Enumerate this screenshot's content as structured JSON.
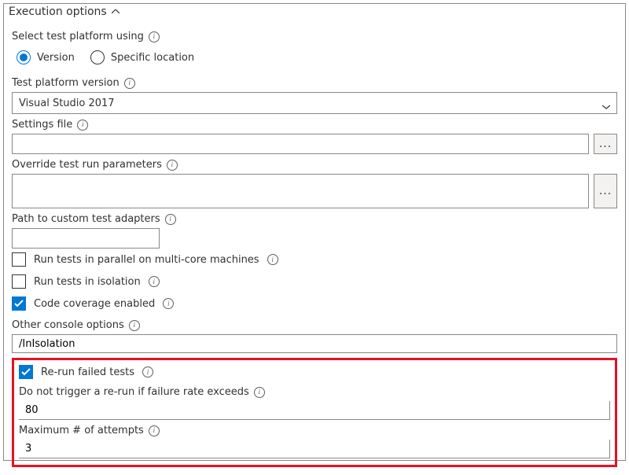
{
  "header": {
    "title": "Execution options"
  },
  "selectPlatform": {
    "label": "Select test platform using",
    "options": {
      "version": "Version",
      "specific": "Specific location"
    },
    "selected": "version"
  },
  "platformVersion": {
    "label": "Test platform version",
    "value": "Visual Studio 2017"
  },
  "settingsFile": {
    "label": "Settings file",
    "value": ""
  },
  "overrideParams": {
    "label": "Override test run parameters",
    "value": ""
  },
  "customAdapters": {
    "label": "Path to custom test adapters",
    "value": ""
  },
  "checkboxes": {
    "parallel": "Run tests in parallel on multi-core machines",
    "isolation": "Run tests in isolation",
    "coverage": "Code coverage enabled"
  },
  "otherConsole": {
    "label": "Other console options",
    "value": "/InIsolation"
  },
  "rerun": {
    "label": "Re-run failed tests",
    "failRate": {
      "label": "Do not trigger a re-run if failure rate exceeds",
      "value": "80"
    },
    "maxAttempts": {
      "label": "Maximum # of attempts",
      "value": "3"
    }
  },
  "moreGlyph": "..."
}
